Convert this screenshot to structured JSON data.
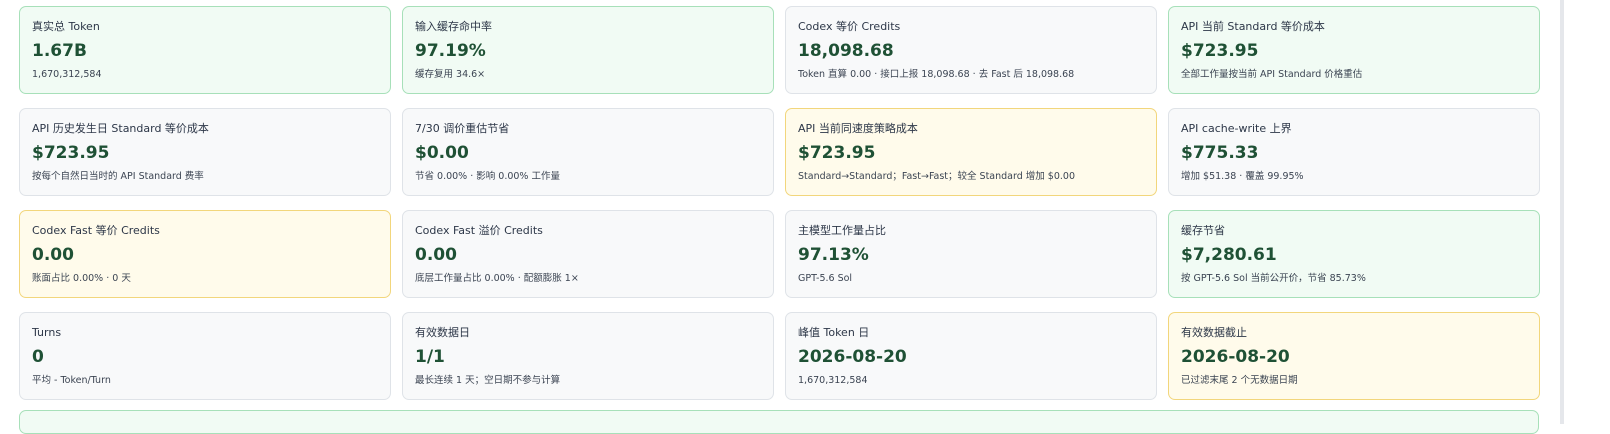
{
  "cards": [
    {
      "label": "真实总 Token",
      "value": "1.67B",
      "sub": "1,670,312,584",
      "tone": "green"
    },
    {
      "label": "输入缓存命中率",
      "value": "97.19%",
      "sub": "缓存复用 34.6×",
      "tone": "green"
    },
    {
      "label": "Codex 等价 Credits",
      "value": "18,098.68",
      "sub": "Token 直算 0.00 · 接口上报 18,098.68 · 去 Fast 后 18,098.68",
      "tone": "neutral"
    },
    {
      "label": "API 当前 Standard 等价成本",
      "value": "$723.95",
      "sub": "全部工作量按当前 API Standard 价格重估",
      "tone": "green"
    },
    {
      "label": "API 历史发生日 Standard 等价成本",
      "value": "$723.95",
      "sub": "按每个自然日当时的 API Standard 费率",
      "tone": "neutral"
    },
    {
      "label": "7/30 调价重估节省",
      "value": "$0.00",
      "sub": "节省 0.00% · 影响 0.00% 工作量",
      "tone": "neutral"
    },
    {
      "label": "API 当前同速度策略成本",
      "value": "$723.95",
      "sub": "Standard→Standard；Fast→Fast；较全 Standard 增加 $0.00",
      "tone": "yellow"
    },
    {
      "label": "API cache-write 上界",
      "value": "$775.33",
      "sub": "增加 $51.38 · 覆盖 99.95%",
      "tone": "neutral"
    },
    {
      "label": "Codex Fast 等价 Credits",
      "value": "0.00",
      "sub": "账面占比 0.00% · 0 天",
      "tone": "yellow"
    },
    {
      "label": "Codex Fast 溢价 Credits",
      "value": "0.00",
      "sub": "底层工作量占比 0.00% · 配额膨胀 1×",
      "tone": "neutral"
    },
    {
      "label": "主模型工作量占比",
      "value": "97.13%",
      "sub": "GPT-5.6 Sol",
      "tone": "neutral"
    },
    {
      "label": "缓存节省",
      "value": "$7,280.61",
      "sub": "按 GPT-5.6 Sol 当前公开价，节省 85.73%",
      "tone": "green"
    },
    {
      "label": "Turns",
      "value": "0",
      "sub": "平均 - Token/Turn",
      "tone": "neutral"
    },
    {
      "label": "有效数据日",
      "value": "1/1",
      "sub": "最长连续 1 天；空日期不参与计算",
      "tone": "neutral"
    },
    {
      "label": "峰值 Token 日",
      "value": "2026-08-20",
      "sub": "1,670,312,584",
      "tone": "neutral"
    },
    {
      "label": "有效数据截止",
      "value": "2026-08-20",
      "sub": "已过滤末尾 2 个无数据日期",
      "tone": "yellow"
    }
  ],
  "colors": {
    "green_bg": "#f1fbf4",
    "yellow_bg": "#fffbeb",
    "neutral_bg": "#f8f9fa",
    "value_text": "#1f5135"
  }
}
